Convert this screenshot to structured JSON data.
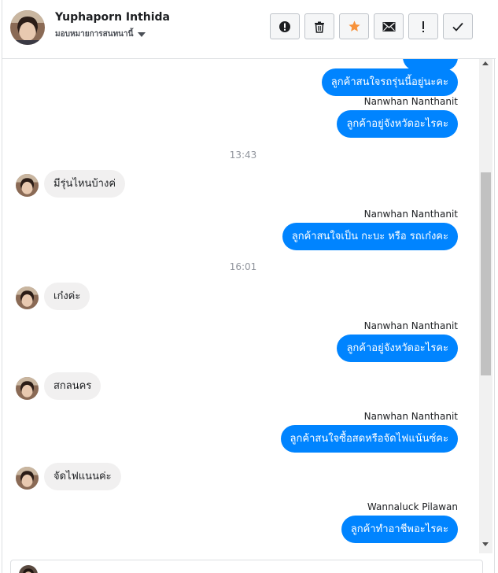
{
  "header": {
    "contact_name": "Yuphaporn Inthida",
    "contact_subtitle": "มอบหมายการสนทนานี้",
    "toolbar": [
      {
        "name": "report-spam",
        "icon": "alert-circle-icon"
      },
      {
        "name": "delete",
        "icon": "trash-icon"
      },
      {
        "name": "star",
        "icon": "star-icon",
        "color": "#f7923b"
      },
      {
        "name": "mark-unread",
        "icon": "envelope-icon"
      },
      {
        "name": "follow-up",
        "icon": "exclamation-icon"
      },
      {
        "name": "mark-done",
        "icon": "check-icon"
      }
    ]
  },
  "messages": {
    "m1": "ลูกค้าสนใจรถรุ่นนี้อยู่นะคะ",
    "s2": "Nanwhan Nanthanit",
    "m2": "ลูกค้าอยู่จังหวัดอะไรคะ",
    "t1": "13:43",
    "m3": "มีรุ่นไหนบ้างค่",
    "s4": "Nanwhan Nanthanit",
    "m4": "ลูกค้าสนใจเป็น กะบะ หรือ รถเก๋งคะ",
    "t2": "16:01",
    "m5": "เก๋งค่ะ",
    "s6": "Nanwhan Nanthanit",
    "m6": "ลูกค้าอยู่จังหวัดอะไรคะ",
    "m7": "สกลนคร",
    "s8": "Nanwhan Nanthanit",
    "m8": "ลูกค้าสนใจซื้อสดหรือจัดไฟแน้นซ์คะ",
    "m9": "จัดไฟแนนค่ะ",
    "s10": "Wannaluck Pilawan",
    "m10": "ลูกค้าทำอาชีพอะไรคะ"
  },
  "colors": {
    "outgoing_bubble": "#0084ff",
    "incoming_bubble": "#f1f0f0",
    "star_accent": "#f7923b"
  }
}
